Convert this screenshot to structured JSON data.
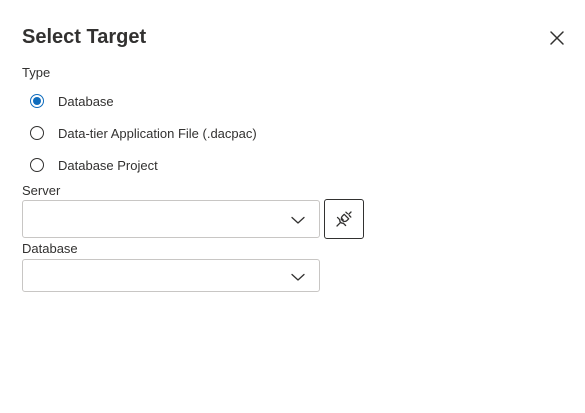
{
  "dialog": {
    "title": "Select Target",
    "close_icon": "close-icon"
  },
  "type_section": {
    "label": "Type",
    "selected_index": 0,
    "options": [
      {
        "label": "Database",
        "checked": true
      },
      {
        "label": "Data-tier Application File (.dacpac)",
        "checked": false
      },
      {
        "label": "Database Project",
        "checked": false
      }
    ]
  },
  "server": {
    "label": "Server",
    "value": "",
    "dropdown_icon": "chevron-down-icon",
    "connect_icon": "plug-connect-icon"
  },
  "database": {
    "label": "Database",
    "value": "",
    "dropdown_icon": "chevron-down-icon"
  },
  "colors": {
    "accent": "#0f6cbd",
    "text": "#323130",
    "border": "#c8c6c4"
  }
}
